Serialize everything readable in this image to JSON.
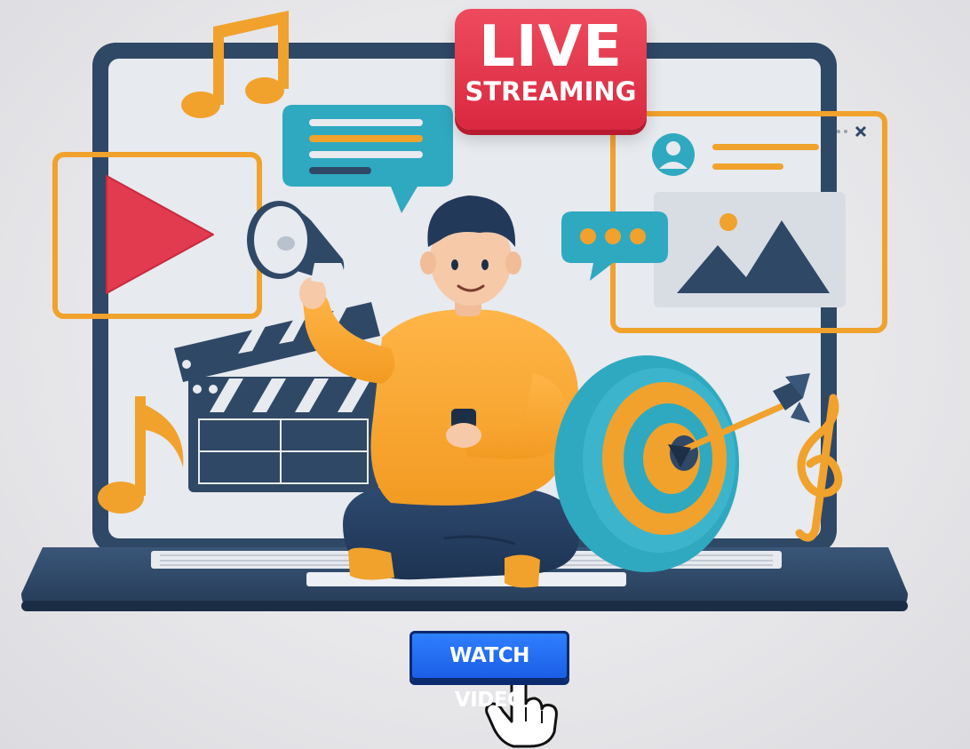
{
  "badge": {
    "line1": "LIVE",
    "line2": "STREAMING"
  },
  "cta": {
    "label": "WATCH VIDEO"
  },
  "colors": {
    "laptop": "#2f4866",
    "screen": "#e6e9ee",
    "accent_orange": "#f0a22d",
    "accent_red": "#e23a4f",
    "accent_teal": "#2fa9c0",
    "button_blue": "#1f6bff"
  },
  "icons": [
    "music-note-icon",
    "chat-bubble-icon",
    "play-icon",
    "megaphone-icon",
    "clapperboard-icon",
    "typing-bubble-icon",
    "profile-card-icon",
    "image-icon",
    "close-icon",
    "target-icon",
    "arrow-icon",
    "treble-clef-icon",
    "hand-cursor-icon"
  ]
}
